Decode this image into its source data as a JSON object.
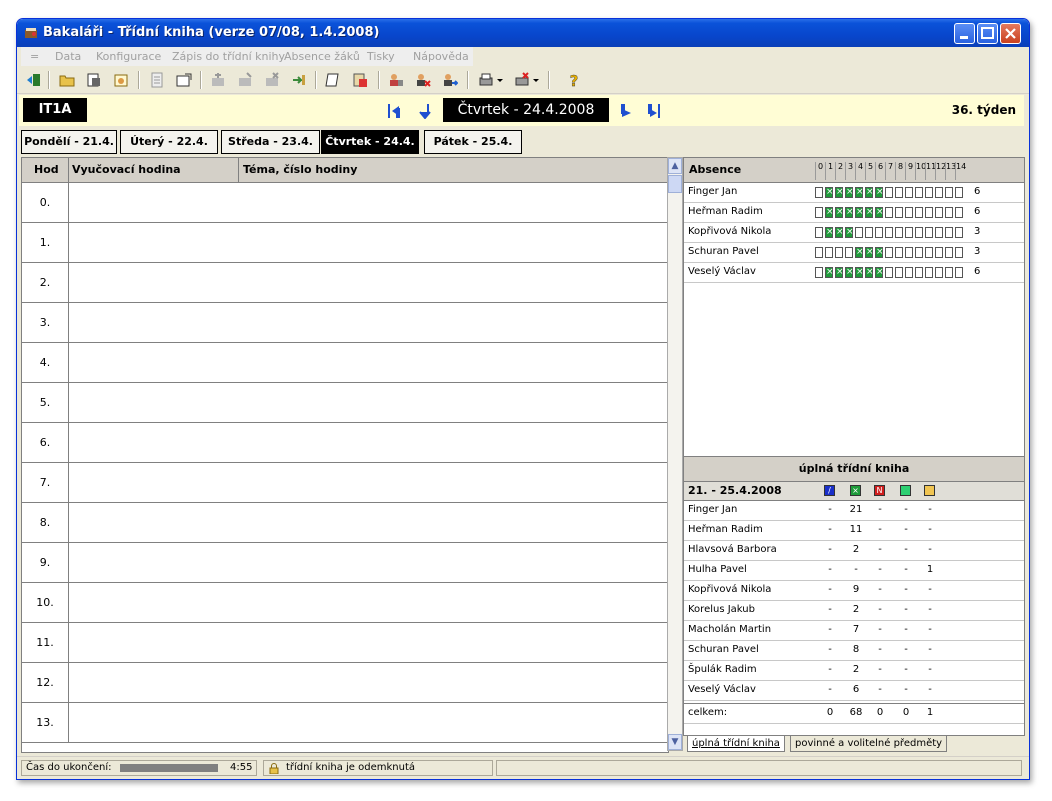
{
  "window": {
    "title": "Bakaláři - Třídní kniha (verze 07/08, 1.4.2008)"
  },
  "menu": {
    "items": [
      "=",
      "Data",
      "Konfigurace",
      "Zápis do třídní knihy",
      "Absence žáků",
      "Tisky",
      "Nápověda"
    ]
  },
  "nav": {
    "class_name": "IT1A",
    "current_date": "Čtvrtek - 24.4.2008",
    "week": "36. týden"
  },
  "day_tabs": [
    {
      "label": "Pondělí - 21.4."
    },
    {
      "label": "Úterý - 22.4."
    },
    {
      "label": "Středa - 23.4."
    },
    {
      "label": "Čtvrtek - 24.4.",
      "active": true
    },
    {
      "label": "Pátek - 25.4."
    }
  ],
  "lessons": {
    "headers": {
      "hod": "Hod",
      "subject": "Vyučovací hodina",
      "topic": "Téma, číslo hodiny"
    },
    "rows": [
      "0.",
      "1.",
      "2.",
      "3.",
      "4.",
      "5.",
      "6.",
      "7.",
      "8.",
      "9.",
      "10.",
      "11.",
      "12.",
      "13."
    ]
  },
  "absence": {
    "header": "Absence",
    "hour_labels": [
      "0",
      "1",
      "2",
      "3",
      "4",
      "5",
      "6",
      "7",
      "8",
      "9",
      "10",
      "11",
      "12",
      "13",
      "14"
    ],
    "students": [
      {
        "name": "Finger Jan",
        "marked": [
          1,
          2,
          3,
          4,
          5,
          6
        ],
        "count": "6"
      },
      {
        "name": "Heřman Radim",
        "marked": [
          1,
          2,
          3,
          4,
          5,
          6
        ],
        "count": "6"
      },
      {
        "name": "Kopřivová Nikola",
        "marked": [
          1,
          2,
          3
        ],
        "count": "3"
      },
      {
        "name": "Schuran Pavel",
        "marked": [
          4,
          5,
          6
        ],
        "count": "3"
      },
      {
        "name": "Veselý Václav",
        "marked": [
          1,
          2,
          3,
          4,
          5,
          6
        ],
        "count": "6"
      }
    ]
  },
  "summary": {
    "title": "úplná třídní kniha",
    "range": "21. - 25.4.2008",
    "legend_colors": [
      "#1a2fc9",
      "#1f9b3a",
      "#d01d1d",
      "#2ed072",
      "#f1c552"
    ],
    "rows": [
      {
        "name": "Finger Jan",
        "vals": [
          "-",
          "21",
          "-",
          "-",
          "-"
        ]
      },
      {
        "name": "Heřman Radim",
        "vals": [
          "-",
          "11",
          "-",
          "-",
          "-"
        ]
      },
      {
        "name": "Hlavsová Barbora",
        "vals": [
          "-",
          "2",
          "-",
          "-",
          "-"
        ]
      },
      {
        "name": "Hulha Pavel",
        "vals": [
          "-",
          "-",
          "-",
          "-",
          "1"
        ]
      },
      {
        "name": "Kopřivová Nikola",
        "vals": [
          "-",
          "9",
          "-",
          "-",
          "-"
        ]
      },
      {
        "name": "Korelus Jakub",
        "vals": [
          "-",
          "2",
          "-",
          "-",
          "-"
        ]
      },
      {
        "name": "Macholán Martin",
        "vals": [
          "-",
          "7",
          "-",
          "-",
          "-"
        ]
      },
      {
        "name": "Schuran Pavel",
        "vals": [
          "-",
          "8",
          "-",
          "-",
          "-"
        ]
      },
      {
        "name": "Špulák Radim",
        "vals": [
          "-",
          "2",
          "-",
          "-",
          "-"
        ]
      },
      {
        "name": "Veselý Václav",
        "vals": [
          "-",
          "6",
          "-",
          "-",
          "-"
        ]
      }
    ],
    "total": {
      "name": "celkem:",
      "vals": [
        "0",
        "68",
        "0",
        "0",
        "1"
      ]
    }
  },
  "bottom_tabs": [
    "úplná třídní kniha",
    "povinné a volitelné předměty"
  ],
  "status": {
    "time_label": "Čas do ukončení:",
    "time_value": "4:55",
    "lock_text": "třídní kniha je odemknutá"
  }
}
